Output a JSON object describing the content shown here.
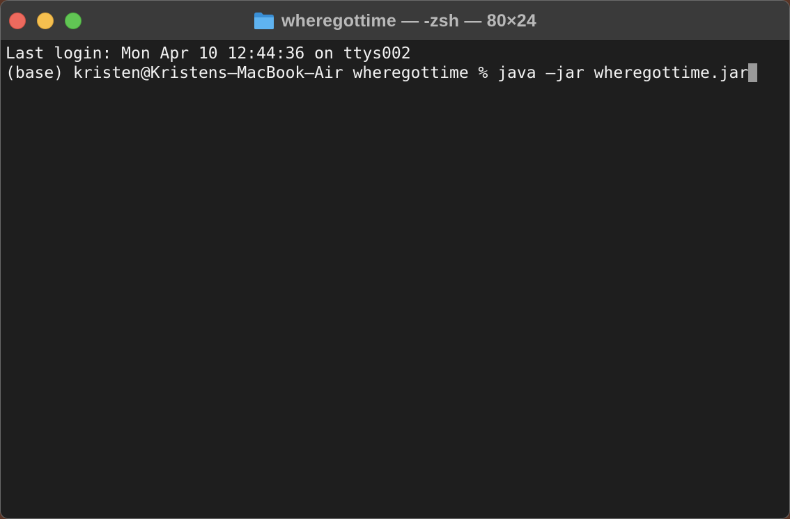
{
  "window": {
    "title": "wheregottime — -zsh — 80×24",
    "folder_icon": "folder-icon",
    "controls": {
      "close_color": "#ed6a5e",
      "minimize_color": "#f5bf4f",
      "zoom_color": "#61c554"
    }
  },
  "terminal": {
    "lines": [
      "Last login: Mon Apr 10 12:44:36 on ttys002",
      "(base) kristen@Kristens–MacBook–Air wheregottime % java –jar wheregottime.jar"
    ],
    "background_color": "#1e1e1e",
    "text_color": "#f2f2f2"
  }
}
